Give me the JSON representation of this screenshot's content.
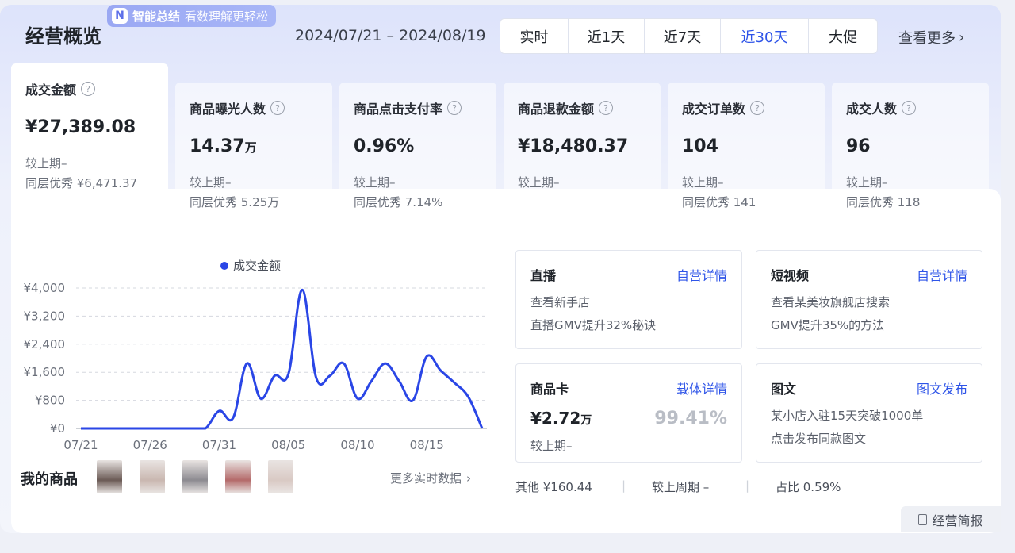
{
  "header": {
    "title": "经营概览",
    "ai_badge_label": "智能总结",
    "ai_badge_sub": "看数理解更轻松",
    "date_range": "2024/07/21 – 2024/08/19",
    "ranges": [
      "实时",
      "近1天",
      "近7天",
      "近30天",
      "大促"
    ],
    "active_range": "近30天",
    "see_more": "查看更多"
  },
  "kpis": [
    {
      "label": "成交金额",
      "value": "¥27,389.08",
      "unit": "",
      "compare": "较上期–",
      "bench": "同层优秀 ¥6,471.37",
      "active": true
    },
    {
      "label": "商品曝光人数",
      "value": "14.37",
      "unit": "万",
      "compare": "较上期–",
      "bench": "同层优秀 5.25万",
      "active": false
    },
    {
      "label": "商品点击支付率",
      "value": "0.96%",
      "unit": "",
      "compare": "较上期–",
      "bench": "同层优秀 7.14%",
      "active": false
    },
    {
      "label": "商品退款金额",
      "value": "¥18,480.37",
      "unit": "",
      "compare": "较上期–",
      "bench": "",
      "active": false
    },
    {
      "label": "成交订单数",
      "value": "104",
      "unit": "",
      "compare": "较上期–",
      "bench": "同层优秀 141",
      "active": false
    },
    {
      "label": "成交人数",
      "value": "96",
      "unit": "",
      "compare": "较上期–",
      "bench": "同层优秀 118",
      "active": false
    }
  ],
  "chart_data": {
    "type": "line",
    "x": [
      "07/21",
      "07/22",
      "07/23",
      "07/24",
      "07/25",
      "07/26",
      "07/27",
      "07/28",
      "07/29",
      "07/30",
      "07/31",
      "08/01",
      "08/02",
      "08/03",
      "08/04",
      "08/05",
      "08/06",
      "08/07",
      "08/08",
      "08/09",
      "08/10",
      "08/11",
      "08/12",
      "08/13",
      "08/14",
      "08/15",
      "08/16",
      "08/17",
      "08/18",
      "08/19"
    ],
    "series": [
      {
        "name": "成交金额",
        "values": [
          0,
          0,
          0,
          0,
          0,
          0,
          0,
          0,
          0,
          0,
          500,
          300,
          1850,
          850,
          1500,
          1550,
          3950,
          1450,
          1500,
          1850,
          850,
          1350,
          1850,
          1350,
          800,
          2050,
          1650,
          1300,
          900,
          0
        ]
      }
    ],
    "xticks": [
      "07/21",
      "07/26",
      "07/31",
      "08/05",
      "08/10",
      "08/15"
    ],
    "yticks": [
      "¥0",
      "¥800",
      "¥1,600",
      "¥2,400",
      "¥3,200",
      "¥4,000"
    ],
    "ylim": [
      0,
      4000
    ],
    "grid": true,
    "legend": "top-center",
    "color": "#2a46e6"
  },
  "products": {
    "label": "我的商品",
    "more": "更多实时数据",
    "thumb_colors": [
      "#6b5a55",
      "#c9b7b0",
      "#8c8a90",
      "#b46a6a",
      "#d9c9c4"
    ]
  },
  "cards": {
    "live": {
      "title": "直播",
      "link": "自营详情",
      "line1": "查看新手店",
      "line2": "直播GMV提升32%秘诀"
    },
    "video": {
      "title": "短视频",
      "link": "自营详情",
      "line1": "查看某美妆旗舰店搜索",
      "line2": "GMV提升35%的方法"
    },
    "product_card": {
      "title": "商品卡",
      "link": "载体详情",
      "value": "¥2.72",
      "unit": "万",
      "pct": "99.41%",
      "compare": "较上期–"
    },
    "graphic": {
      "title": "图文",
      "link": "图文发布",
      "line1": "某小店入驻15天突破1000单",
      "line2": "点击发布同款图文"
    }
  },
  "other": {
    "label": "其他 ¥160.44",
    "compare": "较上周期 –",
    "share": "占比 0.59%"
  },
  "report_button": "经营简报"
}
